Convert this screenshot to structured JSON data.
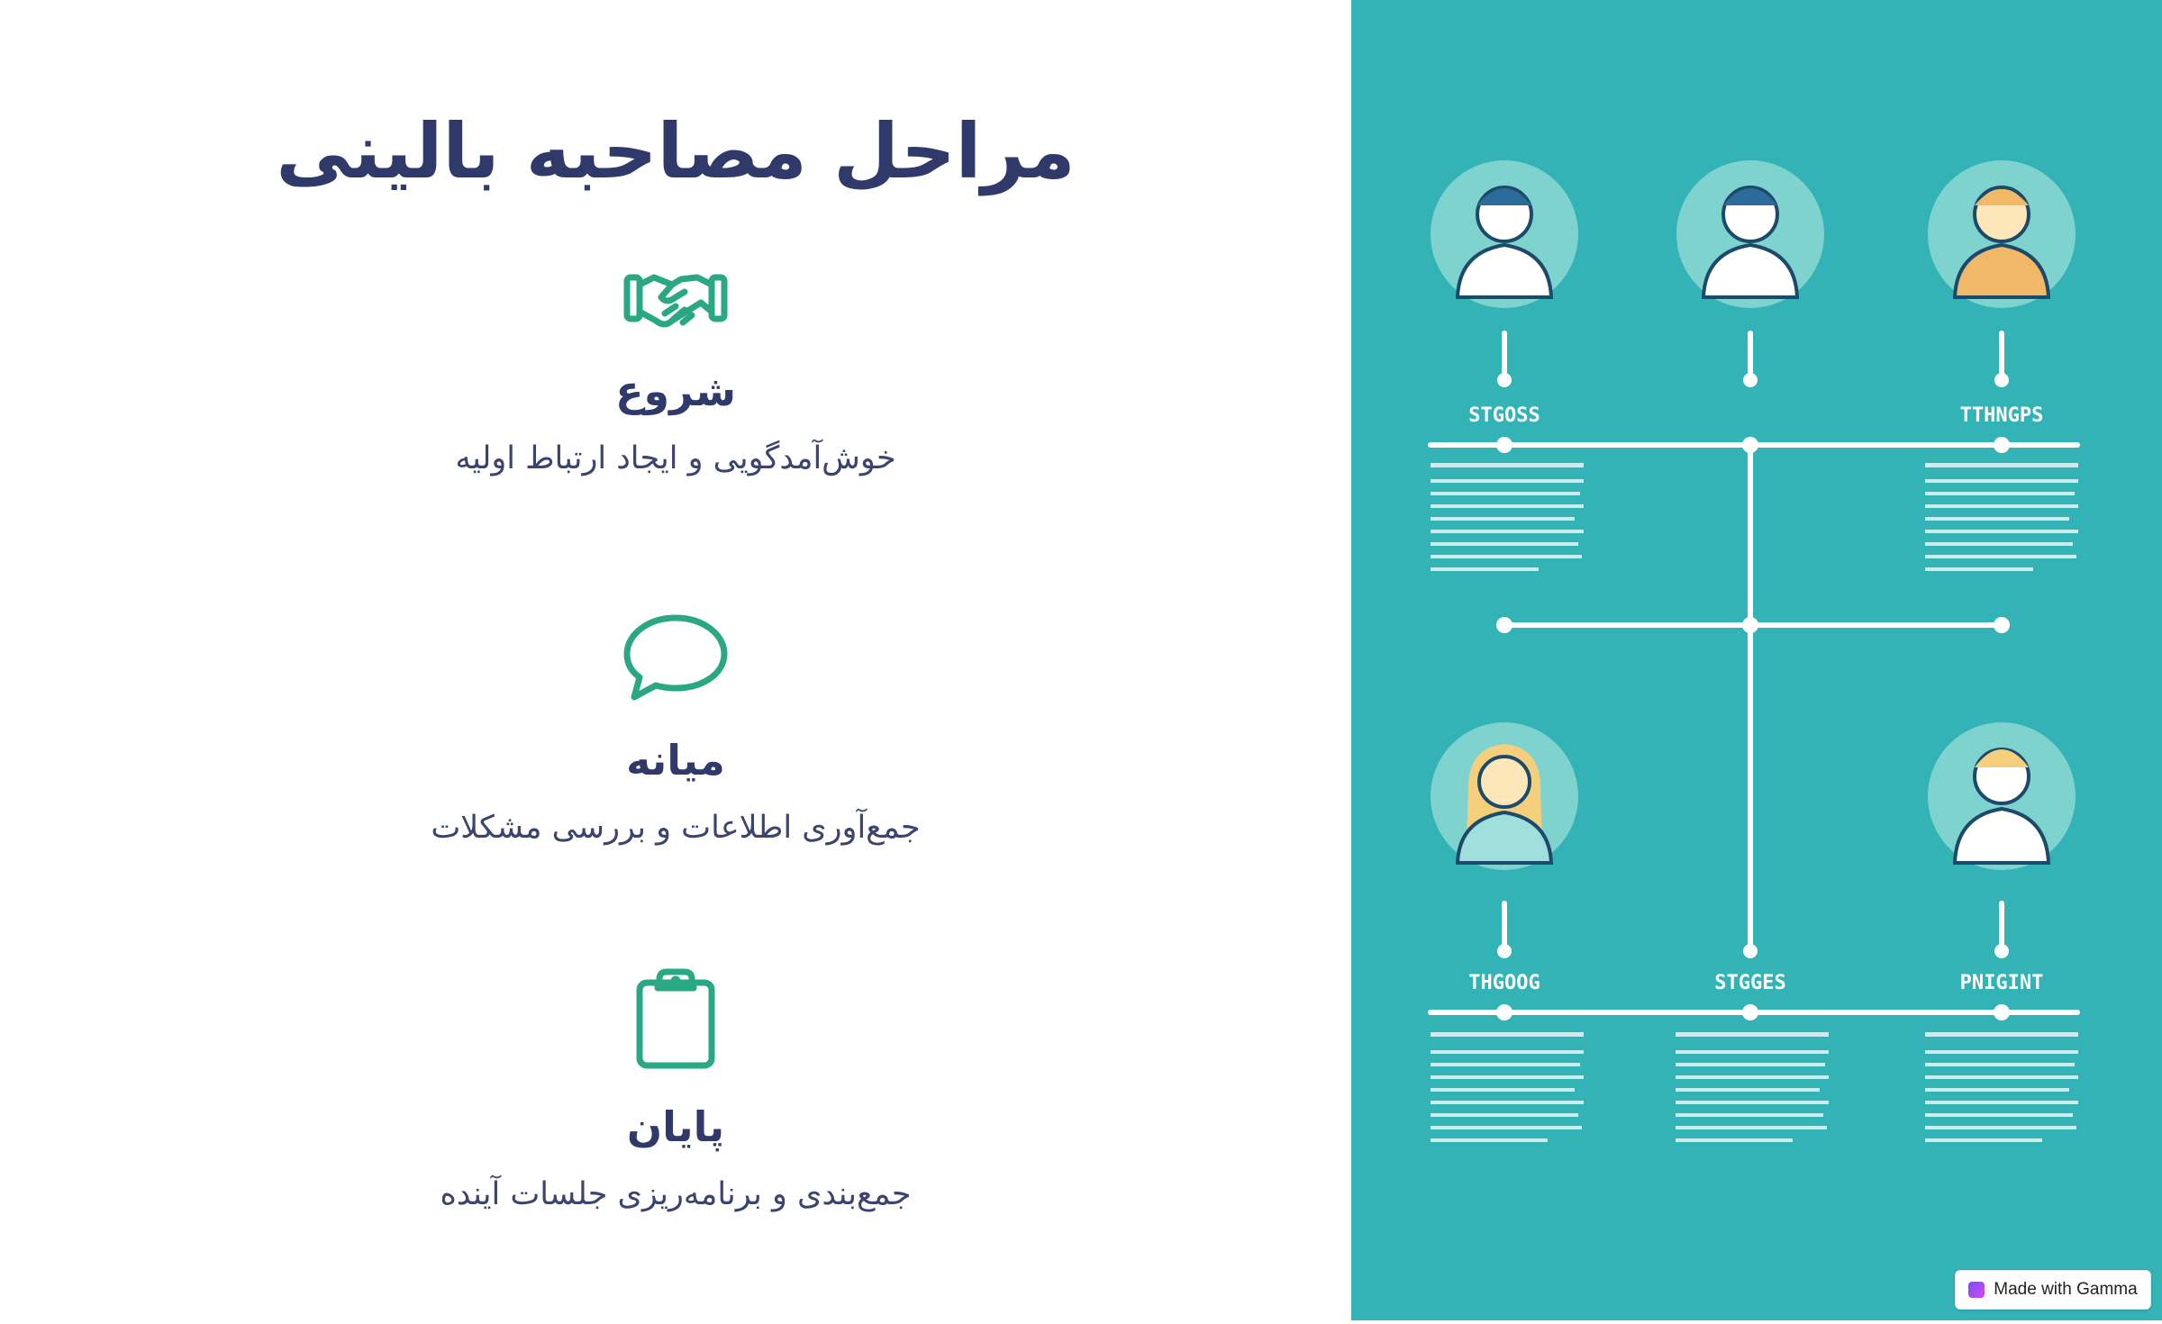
{
  "page": {
    "title": "مراحل مصاحبه بالینی"
  },
  "steps": [
    {
      "icon": "handshake-icon",
      "title": "شروع",
      "description": "خوش‌آمدگویی و ایجاد ارتباط اولیه"
    },
    {
      "icon": "speech-bubble-icon",
      "title": "میانه",
      "description": "جمع‌آوری اطلاعات و بررسی مشکلات"
    },
    {
      "icon": "clipboard-icon",
      "title": "پایان",
      "description": "جمع‌بندی و برنامه‌ریزی جلسات آینده"
    }
  ],
  "illustration": {
    "labels": [
      "STGOSS",
      "TTHNGPS",
      "THGOOG",
      "STGGES",
      "PNIGINT"
    ]
  },
  "badge": {
    "label": "Made with Gamma"
  },
  "colors": {
    "title": "#2f3a6b",
    "icon_accent": "#2aa884",
    "panel": "#34b3b7"
  }
}
